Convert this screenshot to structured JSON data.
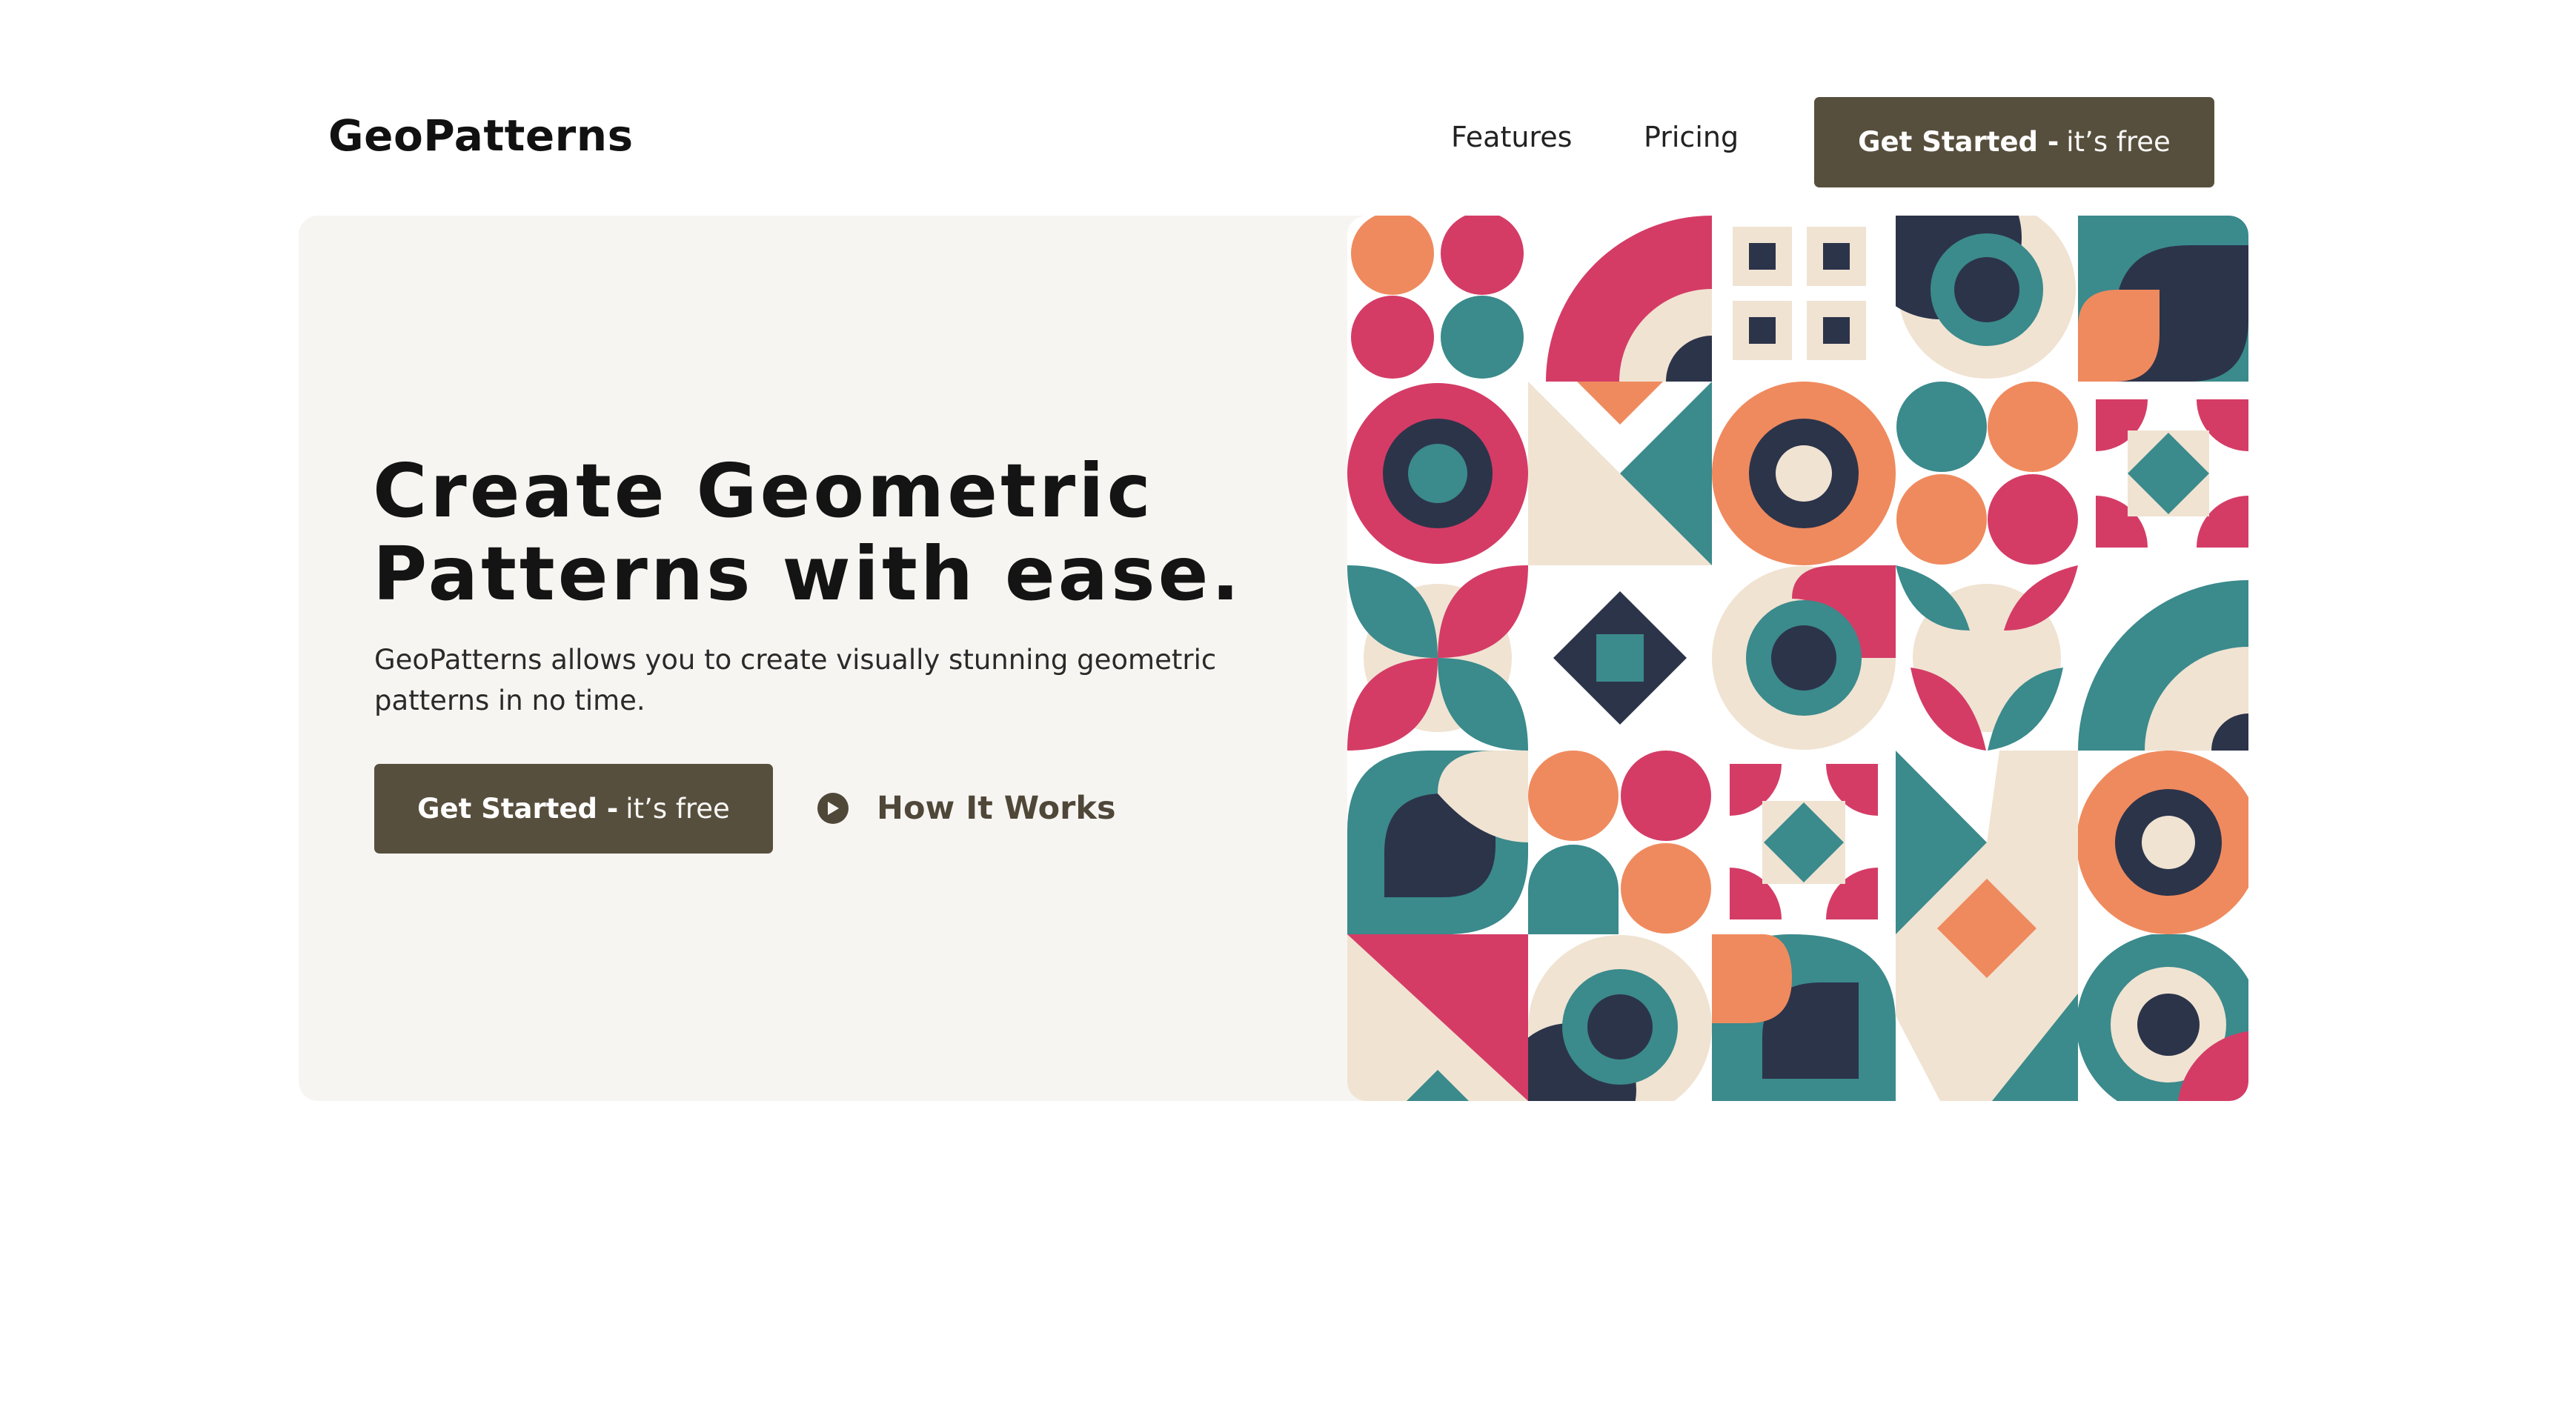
{
  "header": {
    "logo": "GeoPatterns",
    "nav": [
      "Features",
      "Pricing"
    ],
    "cta_bold": "Get Started -",
    "cta_light": "it’s free"
  },
  "hero": {
    "title_line1": "Create Geometric",
    "title_line2": "Patterns with ease.",
    "subtitle_line1": "GeoPatterns allows you to create visually stunning geometric",
    "subtitle_line2": "patterns in no time.",
    "cta_bold": "Get Started -",
    "cta_light": "it’s free",
    "secondary_label": "How It Works",
    "secondary_icon": "play-circle-icon"
  },
  "colors": {
    "button_bg": "#574f3d",
    "hero_bg": "#f7f5f2",
    "pattern_pink": "#d43c66",
    "pattern_teal": "#3b8a8c",
    "pattern_orange": "#ef8a5e",
    "pattern_navy": "#2c344a",
    "pattern_cream": "#f0e3d2"
  }
}
